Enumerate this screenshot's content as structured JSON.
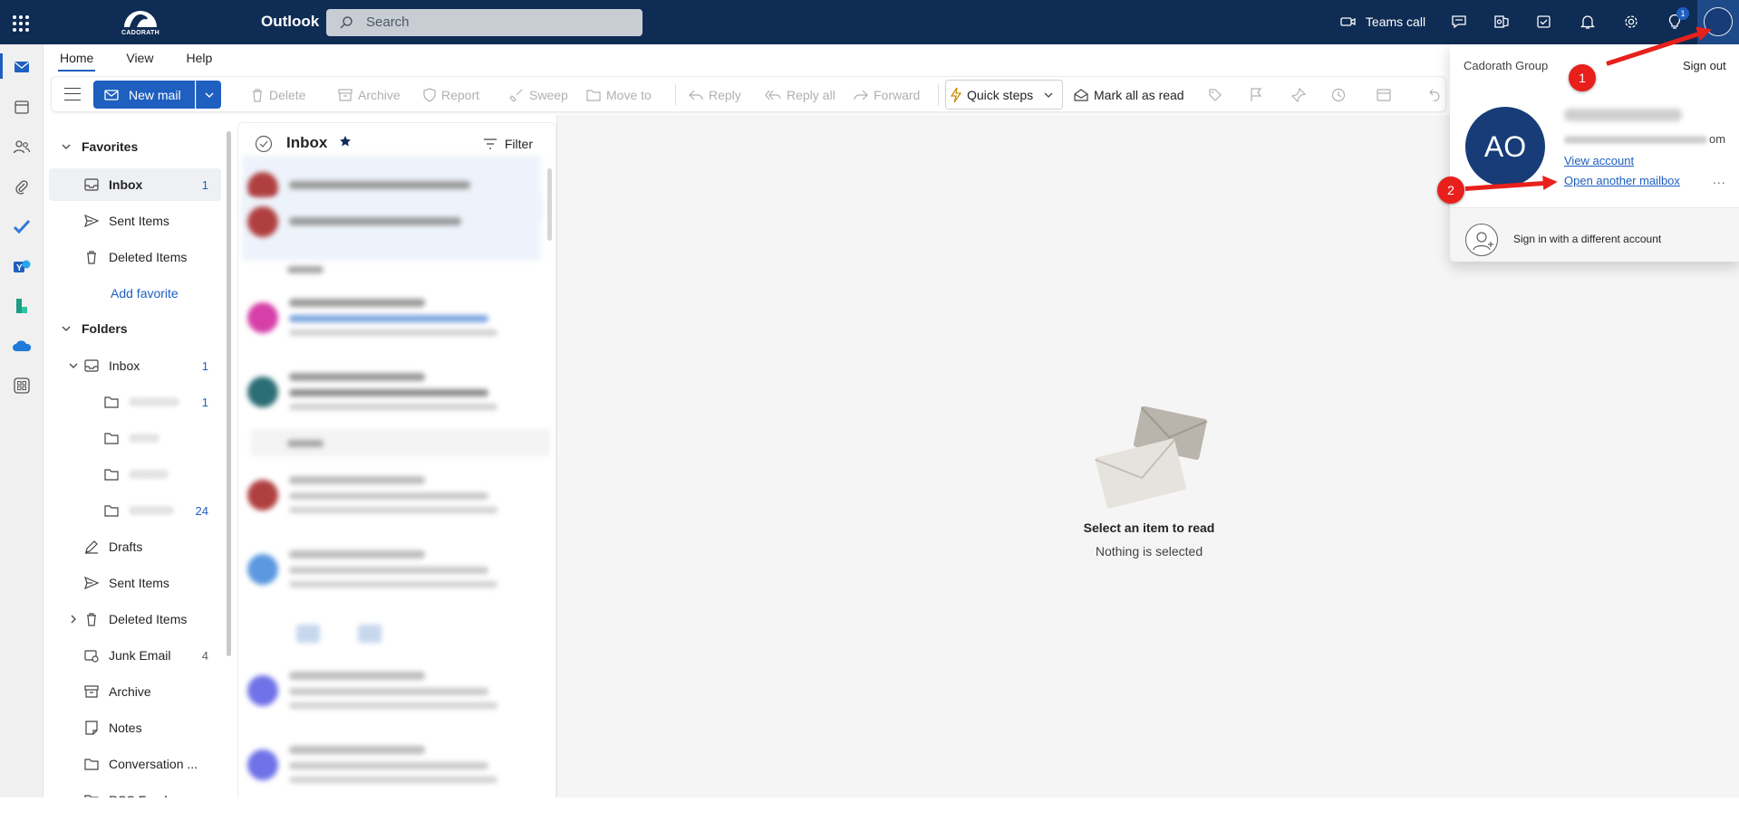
{
  "topbar": {
    "app_name": "Outlook",
    "logo_text": "CADORATH",
    "search_placeholder": "Search",
    "teams_call": "Teams call",
    "tips_badge": "1"
  },
  "ribbon": {
    "tabs": [
      "Home",
      "View",
      "Help"
    ],
    "new_mail": "New mail",
    "delete": "Delete",
    "archive": "Archive",
    "report": "Report",
    "sweep": "Sweep",
    "move_to": "Move to",
    "reply": "Reply",
    "reply_all": "Reply all",
    "forward": "Forward",
    "quick_steps": "Quick steps",
    "mark_all_read": "Mark all as read"
  },
  "folders": {
    "favorites_label": "Favorites",
    "favorites": [
      {
        "label": "Inbox",
        "count": "1"
      },
      {
        "label": "Sent Items",
        "count": ""
      },
      {
        "label": "Deleted Items",
        "count": ""
      }
    ],
    "add_favorite": "Add favorite",
    "folders_label": "Folders",
    "inbox": {
      "label": "Inbox",
      "count": "1"
    },
    "subfolders": [
      {
        "count": "1"
      },
      {
        "count": ""
      },
      {
        "count": ""
      },
      {
        "count": "24"
      }
    ],
    "items": [
      {
        "label": "Drafts",
        "count": ""
      },
      {
        "label": "Sent Items",
        "count": ""
      },
      {
        "label": "Deleted Items",
        "count": ""
      },
      {
        "label": "Junk Email",
        "count": "4"
      },
      {
        "label": "Archive",
        "count": ""
      },
      {
        "label": "Notes",
        "count": ""
      },
      {
        "label": "Conversation ...",
        "count": ""
      },
      {
        "label": "RSS Feeds",
        "count": ""
      }
    ]
  },
  "list": {
    "title": "Inbox",
    "filter": "Filter"
  },
  "reading": {
    "empty_title": "Select an item to read",
    "empty_subtitle": "Nothing is selected"
  },
  "account": {
    "org": "Cadorath Group",
    "sign_out": "Sign out",
    "initials": "AO",
    "email_suffix": "om",
    "view_account": "View account",
    "open_another": "Open another mailbox",
    "more": "...",
    "sign_in_different": "Sign in with a different account"
  },
  "annotations": {
    "step1": "1",
    "step2": "2"
  },
  "colors": {
    "topbar": "#0f2c54",
    "accent": "#1e5fbf",
    "annotation": "#e8201b"
  }
}
